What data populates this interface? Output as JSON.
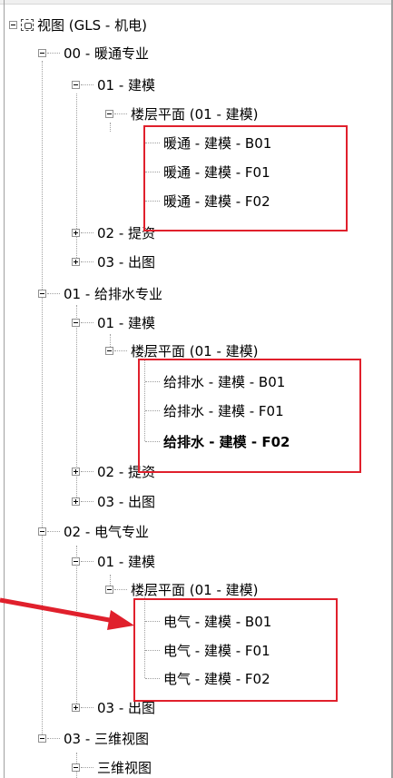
{
  "root": "视图 (GLS - 机电)",
  "hvac": {
    "label": "00 - 暖通专业",
    "modeling": "01 - 建模",
    "floorplan": "楼层平面 (01 - 建模)",
    "views": [
      "暖通 - 建模 - B01",
      "暖通 - 建模 - F01",
      "暖通 - 建模 - F02"
    ],
    "submit": "02 - 提资",
    "output": "03 - 出图"
  },
  "plumbing": {
    "label": "01 - 给排水专业",
    "modeling": "01 - 建模",
    "floorplan": "楼层平面 (01 - 建模)",
    "views": [
      "给排水 - 建模 - B01",
      "给排水 - 建模 - F01",
      "给排水 - 建模 - F02"
    ],
    "submit": "02 - 提资",
    "output": "03 - 出图"
  },
  "electrical": {
    "label": "02 - 电气专业",
    "modeling": "01 - 建模",
    "floorplan": "楼层平面 (01 - 建模)",
    "views": [
      "电气 - 建模 - B01",
      "电气 - 建模 - F01",
      "电气 - 建模 - F02"
    ],
    "output": "03 - 出图"
  },
  "threed": {
    "label": "03 - 三维视图",
    "child": "三维视图"
  },
  "colors": {
    "highlight": "#e0202c",
    "tree_line": "#a0a0a0"
  }
}
